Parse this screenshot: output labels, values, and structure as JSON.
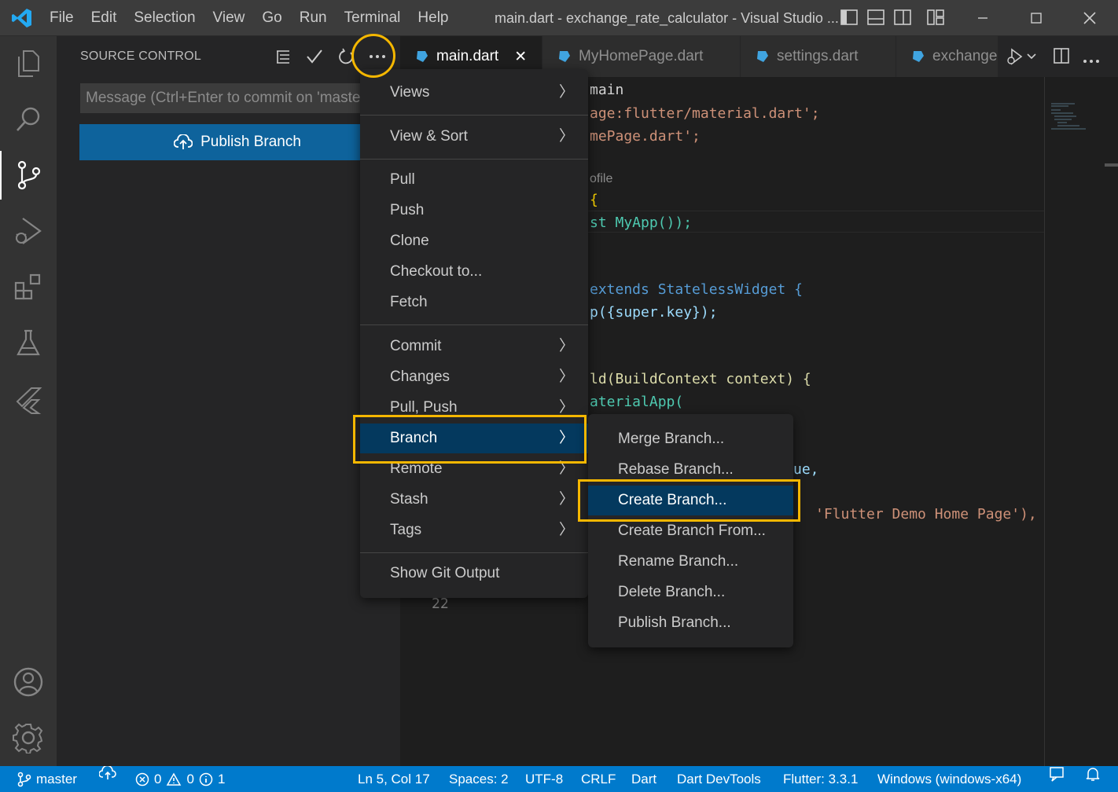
{
  "titlebar": {
    "menu": [
      "File",
      "Edit",
      "Selection",
      "View",
      "Go",
      "Run",
      "Terminal",
      "Help"
    ],
    "window_title": "main.dart - exchange_rate_calculator - Visual Studio ..."
  },
  "activity": {
    "items": [
      "explorer-icon",
      "search-icon",
      "source-control-icon",
      "run-debug-icon",
      "extensions-icon",
      "testing-icon",
      "flutter-icon"
    ],
    "bottom": [
      "account-icon",
      "settings-gear-icon"
    ]
  },
  "sidebar": {
    "title": "SOURCE CONTROL",
    "message_placeholder": "Message (Ctrl+Enter to commit on 'maste",
    "publish_label": "Publish Branch"
  },
  "tabs": [
    {
      "label": "main.dart",
      "close": "✕"
    },
    {
      "label": "MyHomePage.dart"
    },
    {
      "label": "settings.dart"
    },
    {
      "label": "exchange"
    }
  ],
  "code": {
    "lines": [
      {
        "text": "main",
        "color": "#d4d4d4"
      },
      {
        "text": "age:flutter/material.dart';",
        "color": "#ce9178"
      },
      {
        "text": "mePage.dart';",
        "color": "#ce9178"
      },
      {
        "text": "ofile",
        "color": "#8c8c8c"
      },
      {
        "text": "{",
        "color": "#ffd700"
      },
      {
        "text": "st MyApp());",
        "color": "#4ec9b0"
      },
      {
        "text": "extends StatelessWidget {",
        "color": "#569cd6"
      },
      {
        "text": "p({super.key});",
        "color": "#9cdcfe"
      },
      {
        "text": "ld(BuildContext context) {",
        "color": "#dcdcaa"
      },
      {
        "text": "aterialApp(",
        "color": "#4ec9b0"
      },
      {
        "text": "ue,",
        "color": "#9cdcfe"
      },
      {
        "text": "'Flutter Demo Home Page'),",
        "color": "#ce9178"
      }
    ],
    "line_number": "22"
  },
  "main_menu": {
    "items": [
      "Views",
      "View & Sort",
      "Pull",
      "Push",
      "Clone",
      "Checkout to...",
      "Fetch",
      "Commit",
      "Changes",
      "Pull, Push",
      "Branch",
      "Remote",
      "Stash",
      "Tags",
      "Show Git Output"
    ]
  },
  "branch_menu": {
    "items": [
      "Merge Branch...",
      "Rebase Branch...",
      "Create Branch...",
      "Create Branch From...",
      "Rename Branch...",
      "Delete Branch...",
      "Publish Branch..."
    ]
  },
  "statusbar": {
    "branch": "master",
    "errors": "0",
    "warnings": "0",
    "info": "1",
    "position": "Ln 5, Col 17",
    "spaces": "Spaces: 2",
    "encoding": "UTF-8",
    "eol": "CRLF",
    "language": "Dart",
    "devtools": "Dart DevTools",
    "flutter": "Flutter: 3.3.1",
    "device": "Windows (windows-x64)"
  },
  "colors": {
    "accent": "#007acc",
    "highlight": "#f5b700",
    "selection": "#04395e",
    "button": "#0e639c"
  }
}
